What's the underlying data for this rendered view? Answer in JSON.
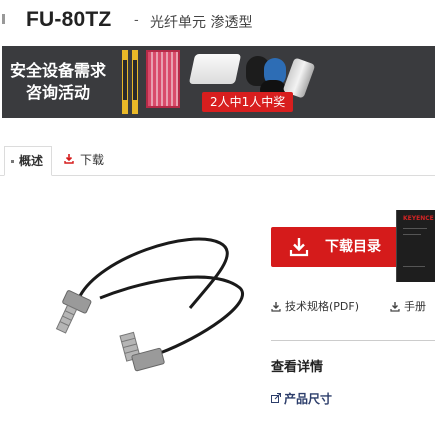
{
  "header": {
    "model": "FU-80TZ",
    "separator": "-",
    "subtitle": "光纤单元 渗透型"
  },
  "banner": {
    "headline_line1": "安全设备需求",
    "headline_line2": "咨询活动",
    "promo_badge": "2人中1人中奖",
    "colors": {
      "background": "#3a3b3e",
      "badge": "#d81e1e"
    }
  },
  "tabs": [
    {
      "label": "概述",
      "active": true
    },
    {
      "label": "下载",
      "active": false,
      "icon": "download-icon"
    }
  ],
  "download_panel": {
    "button_label": "下载目录",
    "button_icon": "download-icon",
    "catalog_brand": "KEYENCE",
    "links": [
      {
        "label": "技术规格(PDF)",
        "icon": "download-icon"
      },
      {
        "label": "手册",
        "icon": "download-icon"
      }
    ],
    "details_heading": "查看详情",
    "dimensions_link": "产品尺寸",
    "colors": {
      "accent": "#d51b1b",
      "link": "#2d3e6b"
    }
  }
}
